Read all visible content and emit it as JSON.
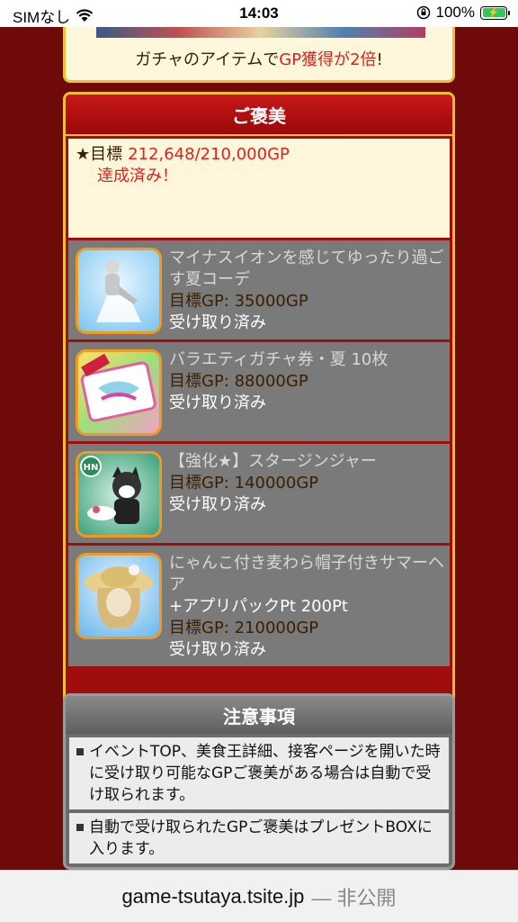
{
  "status_bar": {
    "carrier": "SIMなし",
    "time": "14:03",
    "battery": "100%",
    "wifi_icon": "wifi-icon",
    "lock_icon": "orientation-lock-icon"
  },
  "banner": {
    "text_prefix": "ガチャのアイテムで",
    "text_highlight": "GP獲得が2倍",
    "text_suffix": "!"
  },
  "rewards_panel": {
    "title": "ご褒美",
    "goal_label": "★目標",
    "goal_value": "212,648/210,000GP",
    "goal_status": "達成済み！",
    "items": [
      {
        "name": "マイナスイオンを感じてゆったり過ごす夏コーデ",
        "sub": "",
        "goal_label": "目標GP:",
        "goal_value": "35000GP",
        "status": "受け取り済み"
      },
      {
        "name": "バラエティガチャ券・夏 10枚",
        "sub": "",
        "goal_label": "目標GP:",
        "goal_value": "88000GP",
        "status": "受け取り済み"
      },
      {
        "name": "【強化★】スタージンジャー",
        "sub": "",
        "goal_label": "目標GP:",
        "goal_value": "140000GP",
        "status": "受け取り済み"
      },
      {
        "name": "にゃんこ付き麦わら帽子付きサマーヘア",
        "sub": "+アプリパックPt 200Pt",
        "goal_label": "目標GP:",
        "goal_value": "210000GP",
        "status": "受け取り済み"
      }
    ]
  },
  "notes_panel": {
    "title": "注意事項",
    "items": [
      "イベントTOP、美食王詳細、接客ページを開いた時に受け取り可能なGPご褒美がある場合は自動で受け取られます。",
      "自動で受け取られたGPご褒美はプレゼントBOXに入ります。"
    ]
  },
  "address_bar": {
    "domain": "game-tsutaya.tsite.jp",
    "suffix": "— 非公開"
  }
}
